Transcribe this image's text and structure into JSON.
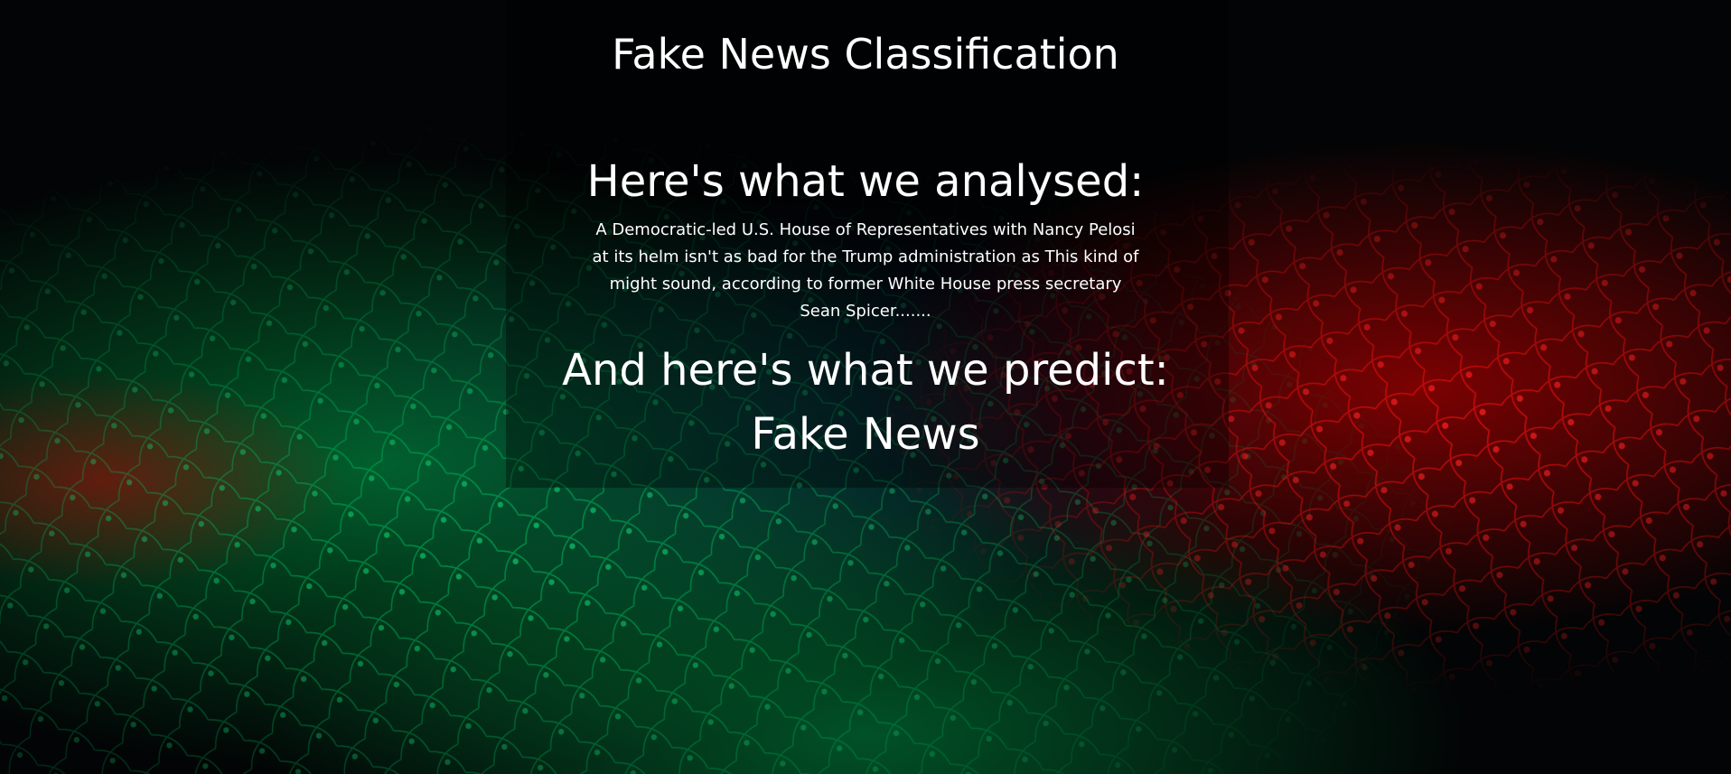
{
  "header": {
    "title": "Fake News Classification"
  },
  "analysis": {
    "heading": "Here's what we analysed:",
    "text": "A Democratic-led U.S. House of Representatives with Nancy Pelosi at its helm isn't as bad for the Trump administration as This kind of might sound, according to former White House press secretary Sean Spicer......."
  },
  "prediction": {
    "heading": "And here's what we predict:",
    "result": "Fake News"
  },
  "background": {
    "image": "network-mesh-background",
    "colors": {
      "green": "#00b050",
      "red": "#e00000",
      "blue": "#0a1a4a",
      "base": "#020405"
    }
  }
}
